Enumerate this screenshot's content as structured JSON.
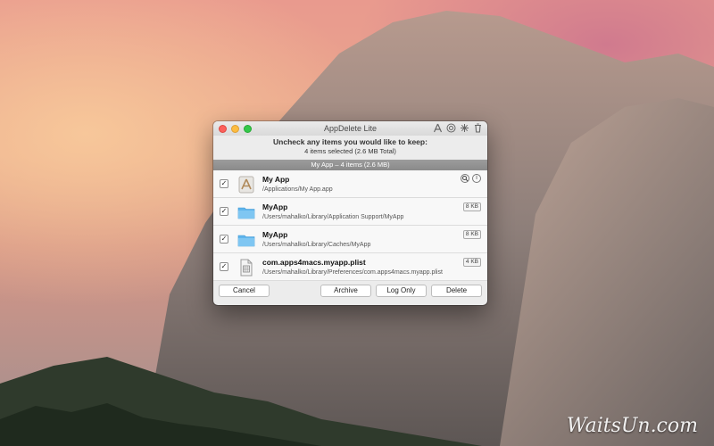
{
  "window": {
    "title": "AppDelete Lite",
    "prompt": "Uncheck any items you would like to keep:",
    "summary": "4 items selected (2.6 MB Total)",
    "group": "My App – 4 items (2.6 MB)"
  },
  "title_icons": [
    "app-store-icon",
    "help-icon",
    "settings-icon",
    "trash-icon"
  ],
  "items": [
    {
      "name": "My App",
      "path": "/Applications/My App.app",
      "checked": true,
      "icon": "app-icon"
    },
    {
      "name": "MyApp",
      "path": "/Users/mahalko/Library/Application Support/MyApp",
      "size": "8 KB",
      "checked": true,
      "icon": "folder-icon"
    },
    {
      "name": "MyApp",
      "path": "/Users/mahalko/Library/Caches/MyApp",
      "size": "8 KB",
      "checked": true,
      "icon": "folder-icon"
    },
    {
      "name": "com.apps4macs.myapp.plist",
      "path": "/Users/mahalko/Library/Preferences/com.apps4macs.myapp.plist",
      "size": "4 KB",
      "checked": true,
      "icon": "document-icon"
    }
  ],
  "buttons": {
    "cancel": "Cancel",
    "archive": "Archive",
    "log_only": "Log Only",
    "delete": "Delete"
  },
  "watermark": "WaitsUn.com",
  "colors": {
    "folder": "#5fb5ec",
    "close": "#fc605c",
    "minimize": "#fdbc40",
    "zoom": "#34c84a"
  }
}
